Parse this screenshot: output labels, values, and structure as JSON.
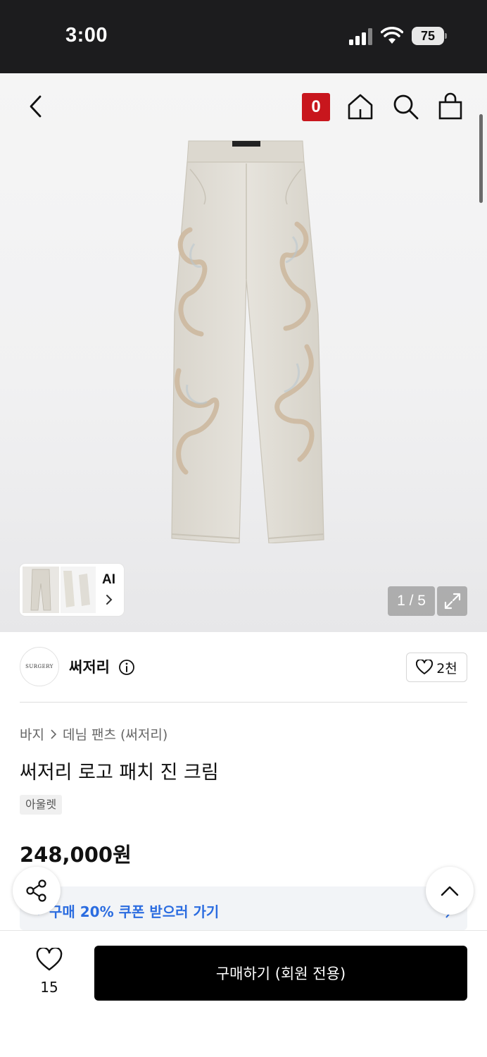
{
  "status_bar": {
    "time": "3:00",
    "battery": "75"
  },
  "header": {
    "cart_count": "0"
  },
  "gallery": {
    "ai_label": "AI",
    "page_indicator": "1 / 5"
  },
  "brand": {
    "logo_text": "SURGERY",
    "name": "써저리",
    "likes": "2천"
  },
  "breadcrumb": {
    "category": "바지",
    "subcategory": "데님 팬츠 (써저리)"
  },
  "product": {
    "title": "써저리 로고 패치 진 크림",
    "tag": "아울렛",
    "price": "248,000원"
  },
  "coupon": {
    "text": "구매 20% 쿠폰 받으러 가기"
  },
  "bottom_bar": {
    "wish_count": "15",
    "buy_label": "구매하기 (회원 전용)"
  },
  "colors": {
    "accent_red": "#c8161d",
    "coupon_blue": "#2b6ce0",
    "buy_button": "#000000"
  }
}
